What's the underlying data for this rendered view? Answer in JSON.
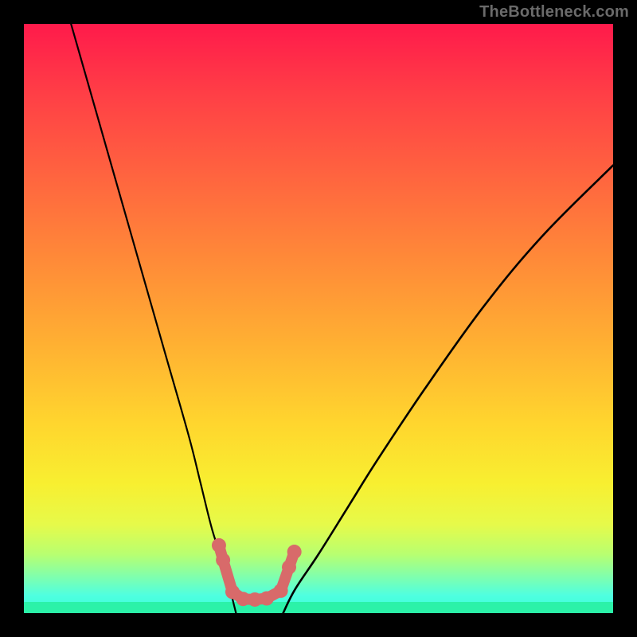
{
  "watermark": {
    "text": "TheBottleneck.com"
  },
  "chart_data": {
    "type": "line",
    "title": "",
    "xlabel": "",
    "ylabel": "",
    "xlim": [
      0,
      100
    ],
    "ylim": [
      0,
      100
    ],
    "grid": false,
    "legend": false,
    "background_gradient": [
      "#ff1a4b",
      "#ffd62e",
      "#2bf2a8"
    ],
    "series": [
      {
        "name": "left-curve",
        "x": [
          8,
          12,
          16,
          20,
          24,
          28,
          30,
          32,
          34,
          35,
          36
        ],
        "y": [
          100,
          86,
          72,
          58,
          44,
          30,
          22,
          14,
          8,
          4,
          0
        ]
      },
      {
        "name": "right-curve",
        "x": [
          44,
          46,
          50,
          55,
          60,
          68,
          78,
          88,
          100
        ],
        "y": [
          0,
          4,
          10,
          18,
          26,
          38,
          52,
          64,
          76
        ]
      }
    ],
    "markers": {
      "name": "highlighted-points",
      "color": "#d86a6a",
      "x": [
        33.1,
        33.8,
        35.4,
        37.2,
        39.2,
        41.2,
        43.6,
        45.0,
        45.9
      ],
      "y": [
        11.5,
        9.0,
        3.6,
        2.4,
        2.3,
        2.5,
        3.8,
        7.8,
        10.4
      ]
    }
  }
}
